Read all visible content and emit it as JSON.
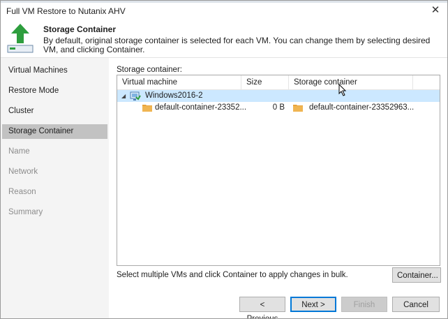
{
  "window": {
    "title": "Full VM Restore to Nutanix AHV",
    "close_icon": "close-icon"
  },
  "header": {
    "title": "Storage Container",
    "description": "By default, original storage container is selected for each VM. You can change them by selecting desired VM, and clicking Container.",
    "icon": "restore-up-arrow-icon"
  },
  "sidebar": {
    "items": [
      {
        "label": "Virtual Machines",
        "state": "enabled"
      },
      {
        "label": "Restore Mode",
        "state": "enabled"
      },
      {
        "label": "Cluster",
        "state": "enabled"
      },
      {
        "label": "Storage Container",
        "state": "selected"
      },
      {
        "label": "Name",
        "state": "disabled"
      },
      {
        "label": "Network",
        "state": "disabled"
      },
      {
        "label": "Reason",
        "state": "disabled"
      },
      {
        "label": "Summary",
        "state": "disabled"
      }
    ]
  },
  "main": {
    "storage_label": "Storage container:",
    "columns": [
      "Virtual machine",
      "Size",
      "Storage container"
    ],
    "rows": [
      {
        "name": "Windows2016-2",
        "size": "",
        "container": "",
        "expanded": true
      },
      {
        "name": "default-container-23352...",
        "size": "0 B",
        "container": "default-container-23352963..."
      }
    ],
    "bulk_note": "Select multiple VMs and click Container to apply changes in bulk.",
    "container_button": "Container..."
  },
  "footer": {
    "previous": "< Previous",
    "next": "Next >",
    "finish": "Finish",
    "cancel": "Cancel"
  },
  "colors": {
    "selected_row": "#cce8ff",
    "selected_nav": "#c2c2c2",
    "folder": "#e8a33c",
    "arrow": "#2e9e3e",
    "primary_border": "#0078d7"
  }
}
